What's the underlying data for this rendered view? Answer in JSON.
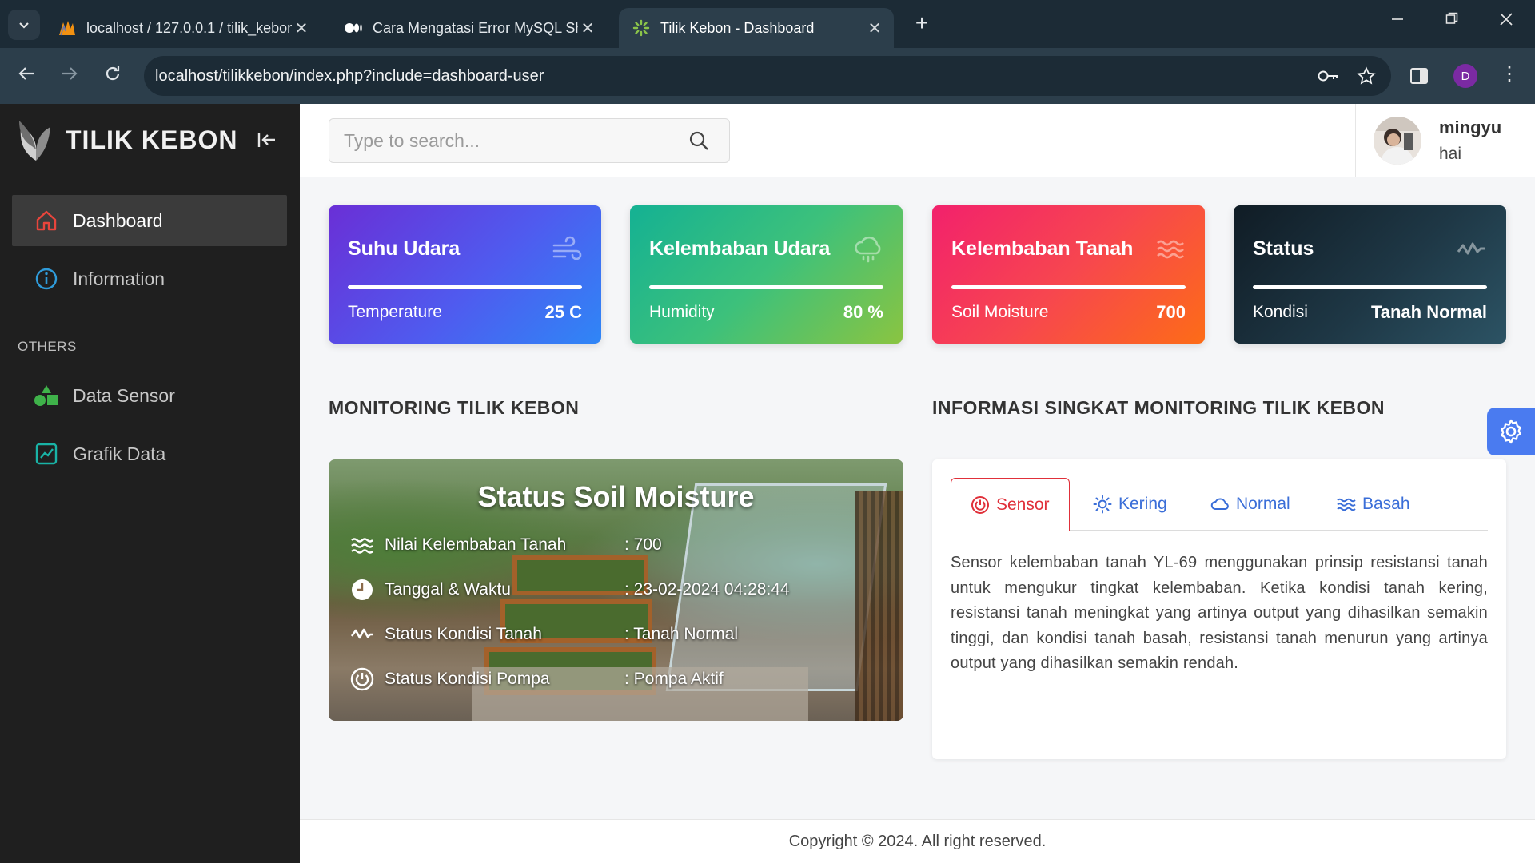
{
  "browser": {
    "tabs": [
      {
        "title": "localhost / 127.0.0.1 / tilik_kebon",
        "active": false
      },
      {
        "title": "Cara Mengatasi Error MySQL Sh",
        "active": false
      },
      {
        "title": "Tilik Kebon - Dashboard",
        "active": true
      }
    ],
    "url": "localhost/tilikkebon/index.php?include=dashboard-user",
    "profile_initial": "D"
  },
  "sidebar": {
    "brand": "TILIK KEBON",
    "items": [
      {
        "label": "Dashboard",
        "icon": "home-icon",
        "active": true
      },
      {
        "label": "Information",
        "icon": "info-icon",
        "active": false
      }
    ],
    "section_label": "OTHERS",
    "others": [
      {
        "label": "Data Sensor",
        "icon": "shapes-icon"
      },
      {
        "label": "Grafik Data",
        "icon": "chart-icon"
      }
    ]
  },
  "header": {
    "search_placeholder": "Type to search...",
    "user": {
      "name": "mingyu",
      "greeting": "hai"
    }
  },
  "cards": [
    {
      "title": "Suhu Udara",
      "label": "Temperature",
      "value": "25 C",
      "icon": "wind-icon"
    },
    {
      "title": "Kelembaban Udara",
      "label": "Humidity",
      "value": "80 %",
      "icon": "cloud-rain-icon"
    },
    {
      "title": "Kelembaban Tanah",
      "label": "Soil Moisture",
      "value": "700",
      "icon": "waves-icon"
    },
    {
      "title": "Status",
      "label": "Kondisi",
      "value": "Tanah Normal",
      "icon": "pulse-icon"
    }
  ],
  "monitoring": {
    "section_title": "MONITORING TILIK KEBON",
    "panel_title": "Status Soil Moisture",
    "rows": [
      {
        "label": "Nilai Kelembaban Tanah",
        "value": ": 700",
        "icon": "waves-icon"
      },
      {
        "label": "Tanggal & Waktu",
        "value": ": 23-02-2024 04:28:44",
        "icon": "clock-icon"
      },
      {
        "label": "Status Kondisi Tanah",
        "value": ": Tanah Normal",
        "icon": "pulse-icon"
      },
      {
        "label": "Status Kondisi Pompa",
        "value": ": Pompa Aktif",
        "icon": "power-icon"
      }
    ]
  },
  "info": {
    "section_title": "INFORMASI SINGKAT MONITORING TILIK KEBON",
    "tabs": [
      {
        "label": "Sensor",
        "icon": "power-icon",
        "active": true
      },
      {
        "label": "Kering",
        "icon": "sun-icon",
        "active": false
      },
      {
        "label": "Normal",
        "icon": "cloud-icon",
        "active": false
      },
      {
        "label": "Basah",
        "icon": "waves-icon",
        "active": false
      }
    ],
    "text": "Sensor kelembaban tanah YL-69 menggunakan prinsip resistansi tanah untuk mengukur tingkat kelembaban. Ketika kondisi tanah kering, resistansi tanah meningkat yang artinya output yang dihasilkan semakin tinggi, dan kondisi tanah basah, resistansi tanah menurun yang artinya output yang dihasilkan semakin rendah."
  },
  "footer": {
    "text": "Copyright © 2024. All right reserved."
  },
  "colors": {
    "accent_red": "#e0303a",
    "link_blue": "#3a6ed8",
    "sidebar_bg": "#1f1f1f",
    "settings_blue": "#4a7bf0"
  }
}
